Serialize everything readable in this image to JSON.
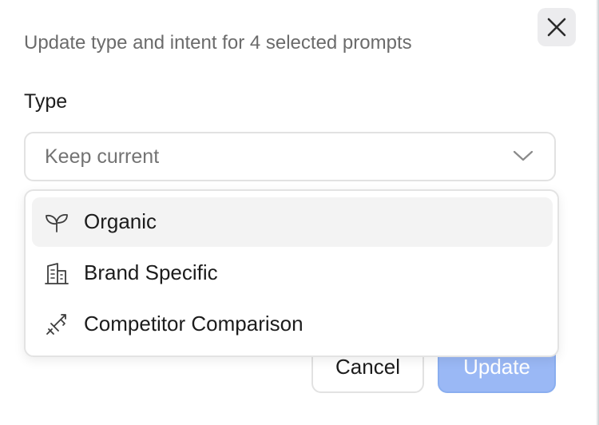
{
  "dialog": {
    "subtitle": "Update type and intent for 4 selected prompts",
    "type_label": "Type",
    "type_select": {
      "value": "Keep current",
      "open": true
    },
    "type_options": [
      {
        "label": "Organic",
        "icon": "sprout-icon",
        "highlighted": true
      },
      {
        "label": "Brand Specific",
        "icon": "building-icon",
        "highlighted": false
      },
      {
        "label": "Competitor Comparison",
        "icon": "swords-icon",
        "highlighted": false
      }
    ],
    "buttons": {
      "cancel": "Cancel",
      "update": "Update"
    }
  },
  "colors": {
    "accent": "#9ab8f5",
    "highlight": "#f3f3f3",
    "muted_text": "#6b6b6b"
  }
}
